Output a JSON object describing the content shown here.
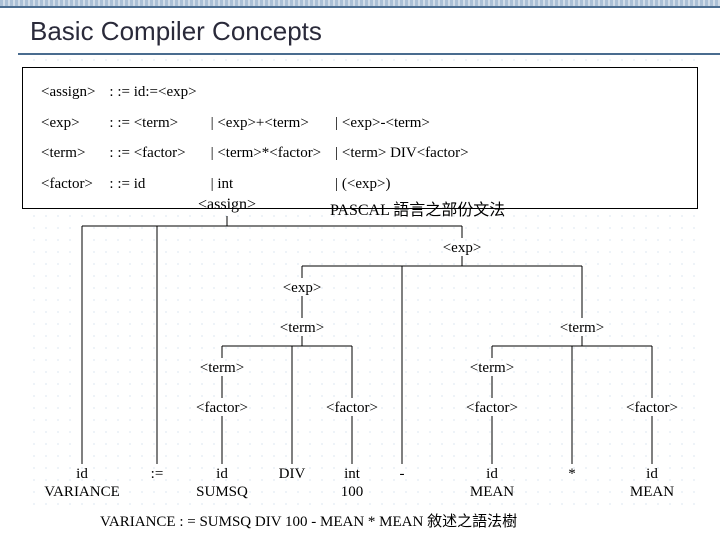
{
  "title": "Basic Compiler Concepts",
  "grammar_caption": "PASCAL 語言之部份文法",
  "grammar": {
    "r1": {
      "lhs": "<assign>",
      "rhs1": ": := id:=<exp>"
    },
    "r2": {
      "lhs": "<exp>",
      "rhs1": ": := <term>",
      "rhs2": "|    <exp>+<term>",
      "rhs3": "|    <exp>-<term>"
    },
    "r3": {
      "lhs": "<term>",
      "rhs1": ": := <factor>",
      "rhs2": "|    <term>*<factor>",
      "rhs3": "|    <term> DIV<factor>"
    },
    "r4": {
      "lhs": "<factor>",
      "rhs1": ": := id",
      "rhs2": "|    int",
      "rhs3": "|    (<exp>)"
    }
  },
  "tree": {
    "assign": "<assign>",
    "exp": "<exp>",
    "term": "<term>",
    "factor": "<factor>",
    "id": "id",
    "int": "int",
    "assign_op": ":=",
    "div": "DIV",
    "minus": "-",
    "star": "*",
    "leaf_variance": "VARIANCE",
    "leaf_sumsq": "SUMSQ",
    "leaf_100": "100",
    "leaf_mean": "MEAN"
  },
  "bottom_line": "VARIANCE : = SUMSQ DIV 100 - MEAN * MEAN 敘述之語法樹"
}
